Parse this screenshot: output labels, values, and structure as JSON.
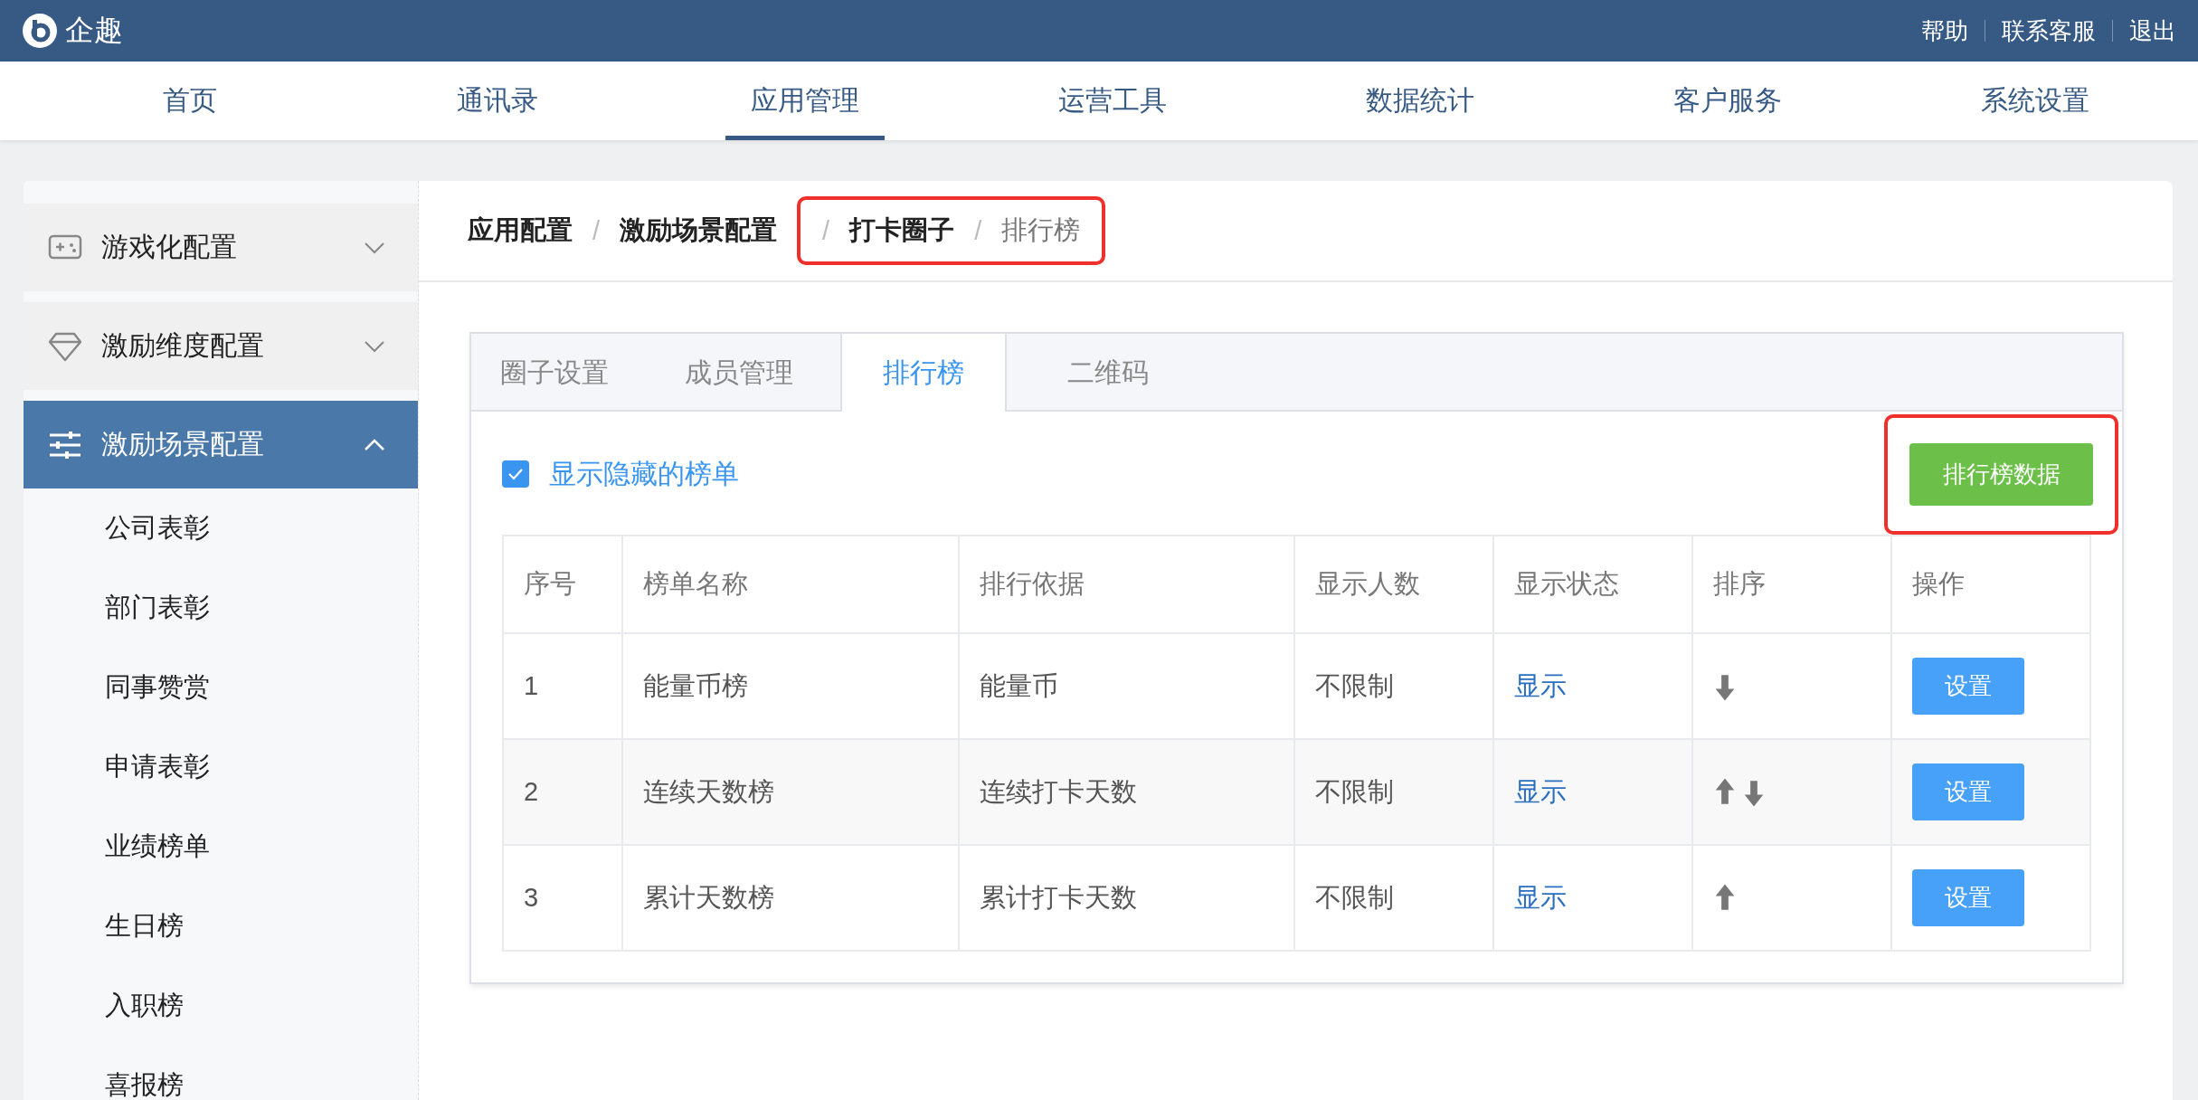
{
  "topbar": {
    "logo_text": "企趣",
    "links": [
      "帮助",
      "联系客服",
      "退出"
    ]
  },
  "nav": [
    {
      "label": "首页",
      "selected": false
    },
    {
      "label": "通讯录",
      "selected": false
    },
    {
      "label": "应用管理",
      "selected": true
    },
    {
      "label": "运营工具",
      "selected": false
    },
    {
      "label": "数据统计",
      "selected": false
    },
    {
      "label": "客户服务",
      "selected": false
    },
    {
      "label": "系统设置",
      "selected": false
    }
  ],
  "sidebar": {
    "items": [
      {
        "label": "游戏化配置",
        "kind": "gamepad",
        "expanded": false,
        "selected": false
      },
      {
        "label": "激励维度配置",
        "kind": "diamond",
        "expanded": false,
        "selected": false
      },
      {
        "label": "激励场景配置",
        "kind": "sliders",
        "expanded": true,
        "selected": true,
        "children": [
          "公司表彰",
          "部门表彰",
          "同事赞赏",
          "申请表彰",
          "业绩榜单",
          "生日榜",
          "入职榜",
          "喜报榜"
        ]
      }
    ]
  },
  "breadcrumb": [
    {
      "label": "应用配置",
      "current": false,
      "highlighted": false
    },
    {
      "separator": "/",
      "label": "激励场景配置",
      "current": false,
      "highlighted": false
    },
    {
      "separator": "/",
      "label": "打卡圈子",
      "current": false,
      "highlighted": true
    },
    {
      "separator": "/",
      "label": "排行榜",
      "current": true,
      "highlighted": true
    }
  ],
  "tabs": [
    {
      "label": "圈子设置",
      "selected": false
    },
    {
      "label": "成员管理",
      "selected": false
    },
    {
      "label": "排行榜",
      "selected": true
    },
    {
      "label": "二维码",
      "selected": false
    }
  ],
  "show_hidden": {
    "label": "显示隐藏的榜单",
    "checked": true
  },
  "data_button": {
    "label": "排行榜数据",
    "highlighted": true
  },
  "table": {
    "columns": [
      "序号",
      "榜单名称",
      "排行依据",
      "显示人数",
      "显示状态",
      "排序",
      "操作"
    ],
    "rows": [
      {
        "index": "1",
        "name": "能量币榜",
        "basis": "能量币",
        "count": "不限制",
        "status": "显示",
        "can_move_up": false,
        "can_move_down": true,
        "action": "设置"
      },
      {
        "index": "2",
        "name": "连续天数榜",
        "basis": "连续打卡天数",
        "count": "不限制",
        "status": "显示",
        "can_move_up": true,
        "can_move_down": true,
        "action": "设置"
      },
      {
        "index": "3",
        "name": "累计天数榜",
        "basis": "累计打卡天数",
        "count": "不限制",
        "status": "显示",
        "can_move_up": true,
        "can_move_down": false,
        "action": "设置"
      }
    ]
  }
}
